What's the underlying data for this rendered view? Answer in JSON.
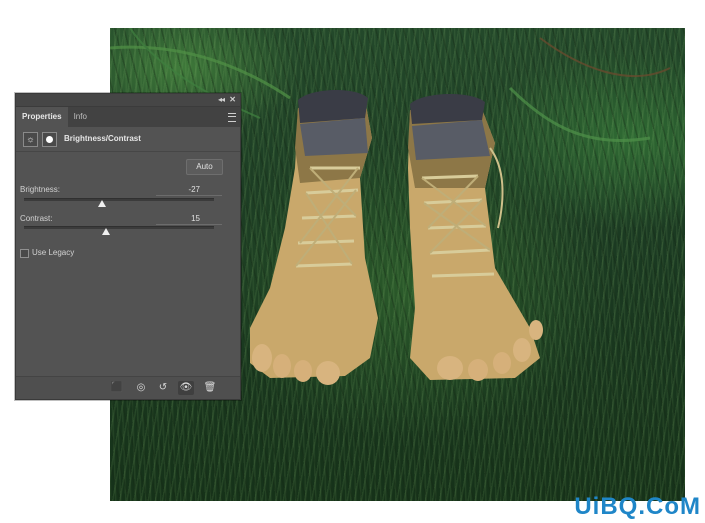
{
  "panel": {
    "tabs": [
      {
        "label": "Properties",
        "active": true
      },
      {
        "label": "Info",
        "active": false
      }
    ],
    "collapse_glyph": "◂◂",
    "close_glyph": "✕",
    "adjustment_icon": "sun-icon",
    "adjustment_title": "Brightness/Contrast",
    "auto_label": "Auto",
    "brightness": {
      "label": "Brightness:",
      "value": "-27",
      "min": -150,
      "max": 150
    },
    "contrast": {
      "label": "Contrast:",
      "value": "15",
      "min": -50,
      "max": 100
    },
    "use_legacy": {
      "label": "Use Legacy",
      "checked": false
    },
    "footer_icons": [
      "clip-to-layer-icon",
      "view-previous-state-icon",
      "reset-icon",
      "visibility-eye-icon",
      "delete-icon"
    ]
  },
  "watermark": "UiBQ.CoM",
  "colors": {
    "panel_bg": "#535353",
    "tab_bar": "#424242",
    "watermark": "#1f86c8"
  }
}
